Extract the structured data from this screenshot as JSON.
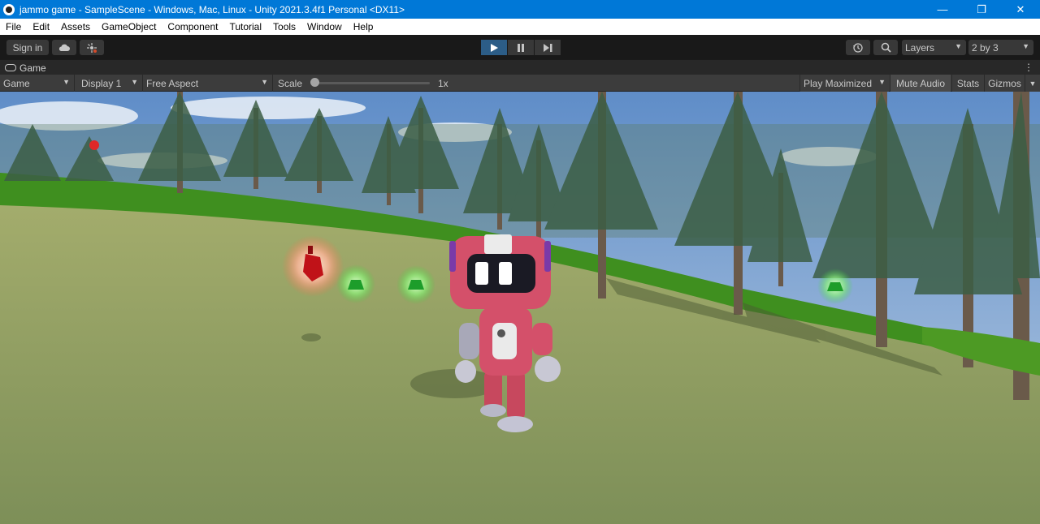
{
  "window": {
    "title": "jammo game - SampleScene - Windows, Mac, Linux - Unity 2021.3.4f1 Personal <DX11>",
    "minimize_glyph": "—",
    "maximize_glyph": "❐",
    "close_glyph": "✕"
  },
  "menu": [
    "File",
    "Edit",
    "Assets",
    "GameObject",
    "Component",
    "Tutorial",
    "Tools",
    "Window",
    "Help"
  ],
  "toolbar": {
    "sign_in_label": "Sign in",
    "cloud_icon": "cloud-icon",
    "collab_icon": "collab-icon",
    "play_icon": "play-icon",
    "pause_icon": "pause-icon",
    "step_icon": "step-icon",
    "history_icon": "history-icon",
    "search_icon": "search-icon",
    "layers_label": "Layers",
    "layout_label": "2 by 3"
  },
  "game_tab": {
    "label": "Game"
  },
  "game_toolbar": {
    "view_mode": "Game",
    "display": "Display 1",
    "aspect": "Free Aspect",
    "scale_label": "Scale",
    "scale_value": "1x",
    "scale_fraction": 0.0,
    "play_maximized": "Play Maximized",
    "mute_audio": "Mute Audio",
    "stats": "Stats",
    "gizmos": "Gizmos"
  },
  "colors": {
    "titlebar": "#0078d7",
    "play_active": "#2c5d87",
    "sky": "#7fa6cf",
    "grass": "#8a9a5a",
    "robot_red": "#c7485e"
  }
}
